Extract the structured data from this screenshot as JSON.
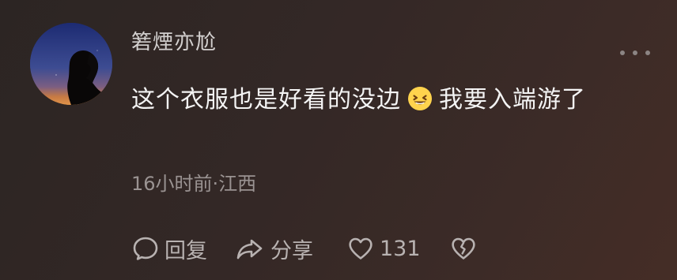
{
  "comment": {
    "username": "箬煙亦尬",
    "text_before_emoji": "这个衣服也是好看的没边",
    "emoji_icon": "grinning-squinting-face",
    "text_after_emoji": "我要入端游了",
    "time": "16小时前",
    "separator": "·",
    "location": "江西"
  },
  "actions": {
    "reply_label": "回复",
    "share_label": "分享",
    "like_count": "131"
  },
  "icons": {
    "more": "more-dots-icon",
    "reply": "comment-bubble-icon",
    "share": "share-arrow-icon",
    "like": "heart-outline-icon",
    "dislike": "broken-heart-icon"
  },
  "colors": {
    "background": "#342826",
    "primary_text": "#f4f4f4",
    "secondary_text": "#9a9392",
    "action_text": "#b8b2b1",
    "emoji_yellow": "#ffd34d"
  }
}
